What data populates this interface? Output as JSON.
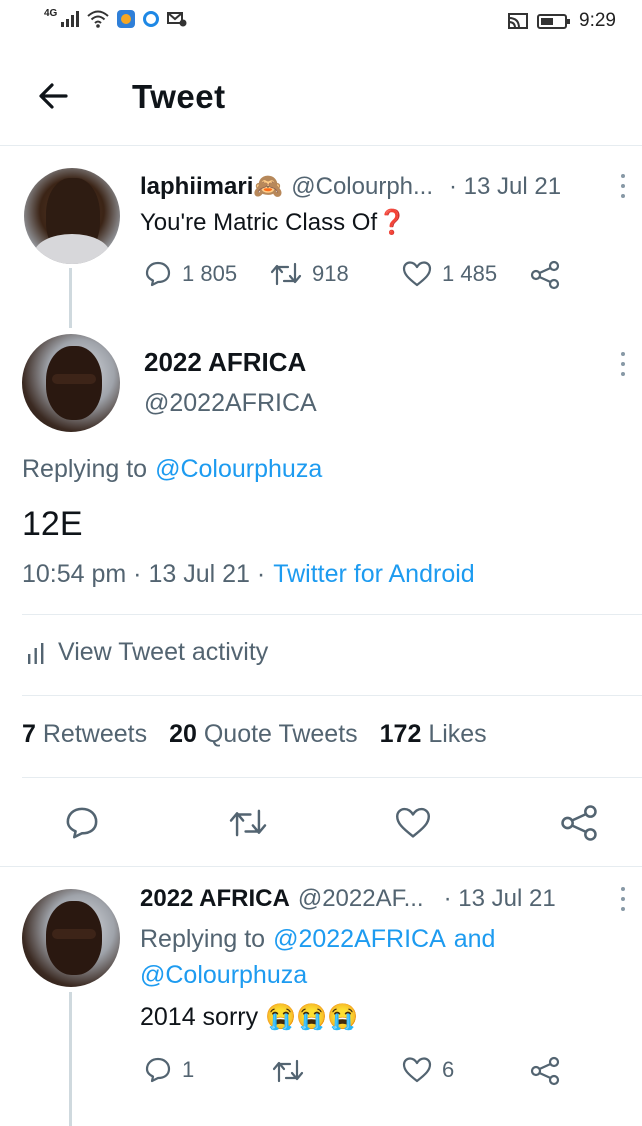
{
  "status_bar": {
    "network": "4G",
    "time": "9:29"
  },
  "header": {
    "back_icon": "arrow-left-icon",
    "title": "Tweet"
  },
  "parent_tweet": {
    "display_name": "laphiimari🙈",
    "handle": "@Colourph...",
    "date": "· 13 Jul 21",
    "text": "You're Matric Class Of❓",
    "replies": "1 805",
    "retweets": "918",
    "likes": "1 485"
  },
  "main_tweet": {
    "display_name": "2022 AFRICA",
    "handle": "@2022AFRICA",
    "replying_prefix": "Replying to",
    "replying_to": "@Colourphuza",
    "text": "12E",
    "time": "10:54 pm · 13 Jul 21 ·",
    "source": "Twitter for Android",
    "activity_label": "View Tweet activity",
    "stats": {
      "retweets_count": "7",
      "retweets_label": "Retweets",
      "quotes_count": "20",
      "quotes_label": "Quote Tweets",
      "likes_count": "172",
      "likes_label": "Likes"
    }
  },
  "reply_tweet": {
    "display_name": "2022 AFRICA",
    "handle": "@2022AF...",
    "date": "· 13 Jul 21",
    "replying_prefix": "Replying to",
    "replying_to_1": "@2022AFRICA",
    "replying_and": "and",
    "replying_to_2": "@Colourphuza",
    "text": "2014 sorry 😭😭😭",
    "replies": "1",
    "likes": "6"
  },
  "colors": {
    "accent": "#1d9bf0",
    "muted": "#536471",
    "divider": "#e6ecf0"
  }
}
